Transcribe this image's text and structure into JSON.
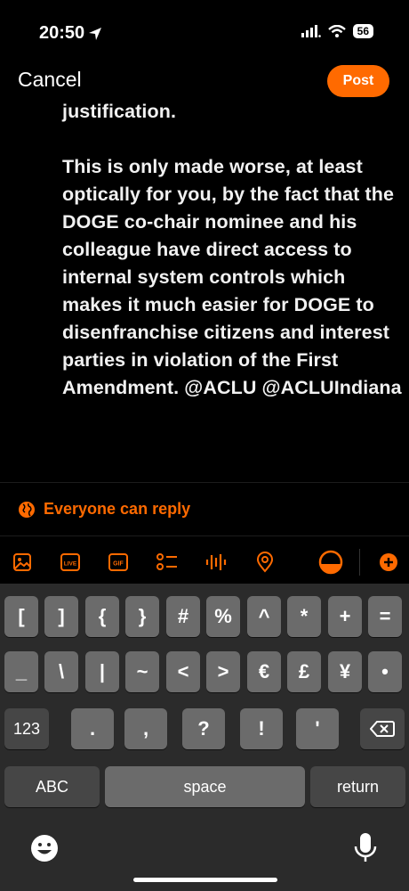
{
  "status": {
    "time": "20:50",
    "battery": "56"
  },
  "header": {
    "cancel": "Cancel",
    "post": "Post"
  },
  "compose": {
    "line_top": "justification.",
    "paragraph": "This is only made worse, at least optically for you, by the fact that the DOGE co-chair nominee and his colleague have direct access to internal system controls which makes it much easier for DOGE to disenfranchise citizens and interest parties in violation of the First Amendment. @ACLU @ACLUIndiana"
  },
  "reply_setting": "Everyone can reply",
  "toolbar": {
    "icons": [
      "image-icon",
      "live-icon",
      "gif-icon",
      "poll-icon",
      "audio-icon",
      "location-icon",
      "character-progress-icon",
      "add-icon"
    ],
    "live_label": "LIVE",
    "gif_label": "GIF"
  },
  "keyboard": {
    "row1": [
      "[",
      "]",
      "{",
      "}",
      "#",
      "%",
      "^",
      "*",
      "+",
      "="
    ],
    "row2": [
      "_",
      "\\",
      "|",
      "~",
      "<",
      ">",
      "€",
      "£",
      "¥",
      "•"
    ],
    "row3": [
      ".",
      ",",
      "?",
      "!",
      "'"
    ],
    "mode_key": "123",
    "abc_key": "ABC",
    "space": "space",
    "return": "return"
  },
  "colors": {
    "accent": "#ff6a00",
    "key": "#6b6b6b",
    "key_dark": "#464646",
    "keyboard_bg": "#2b2b2b"
  }
}
